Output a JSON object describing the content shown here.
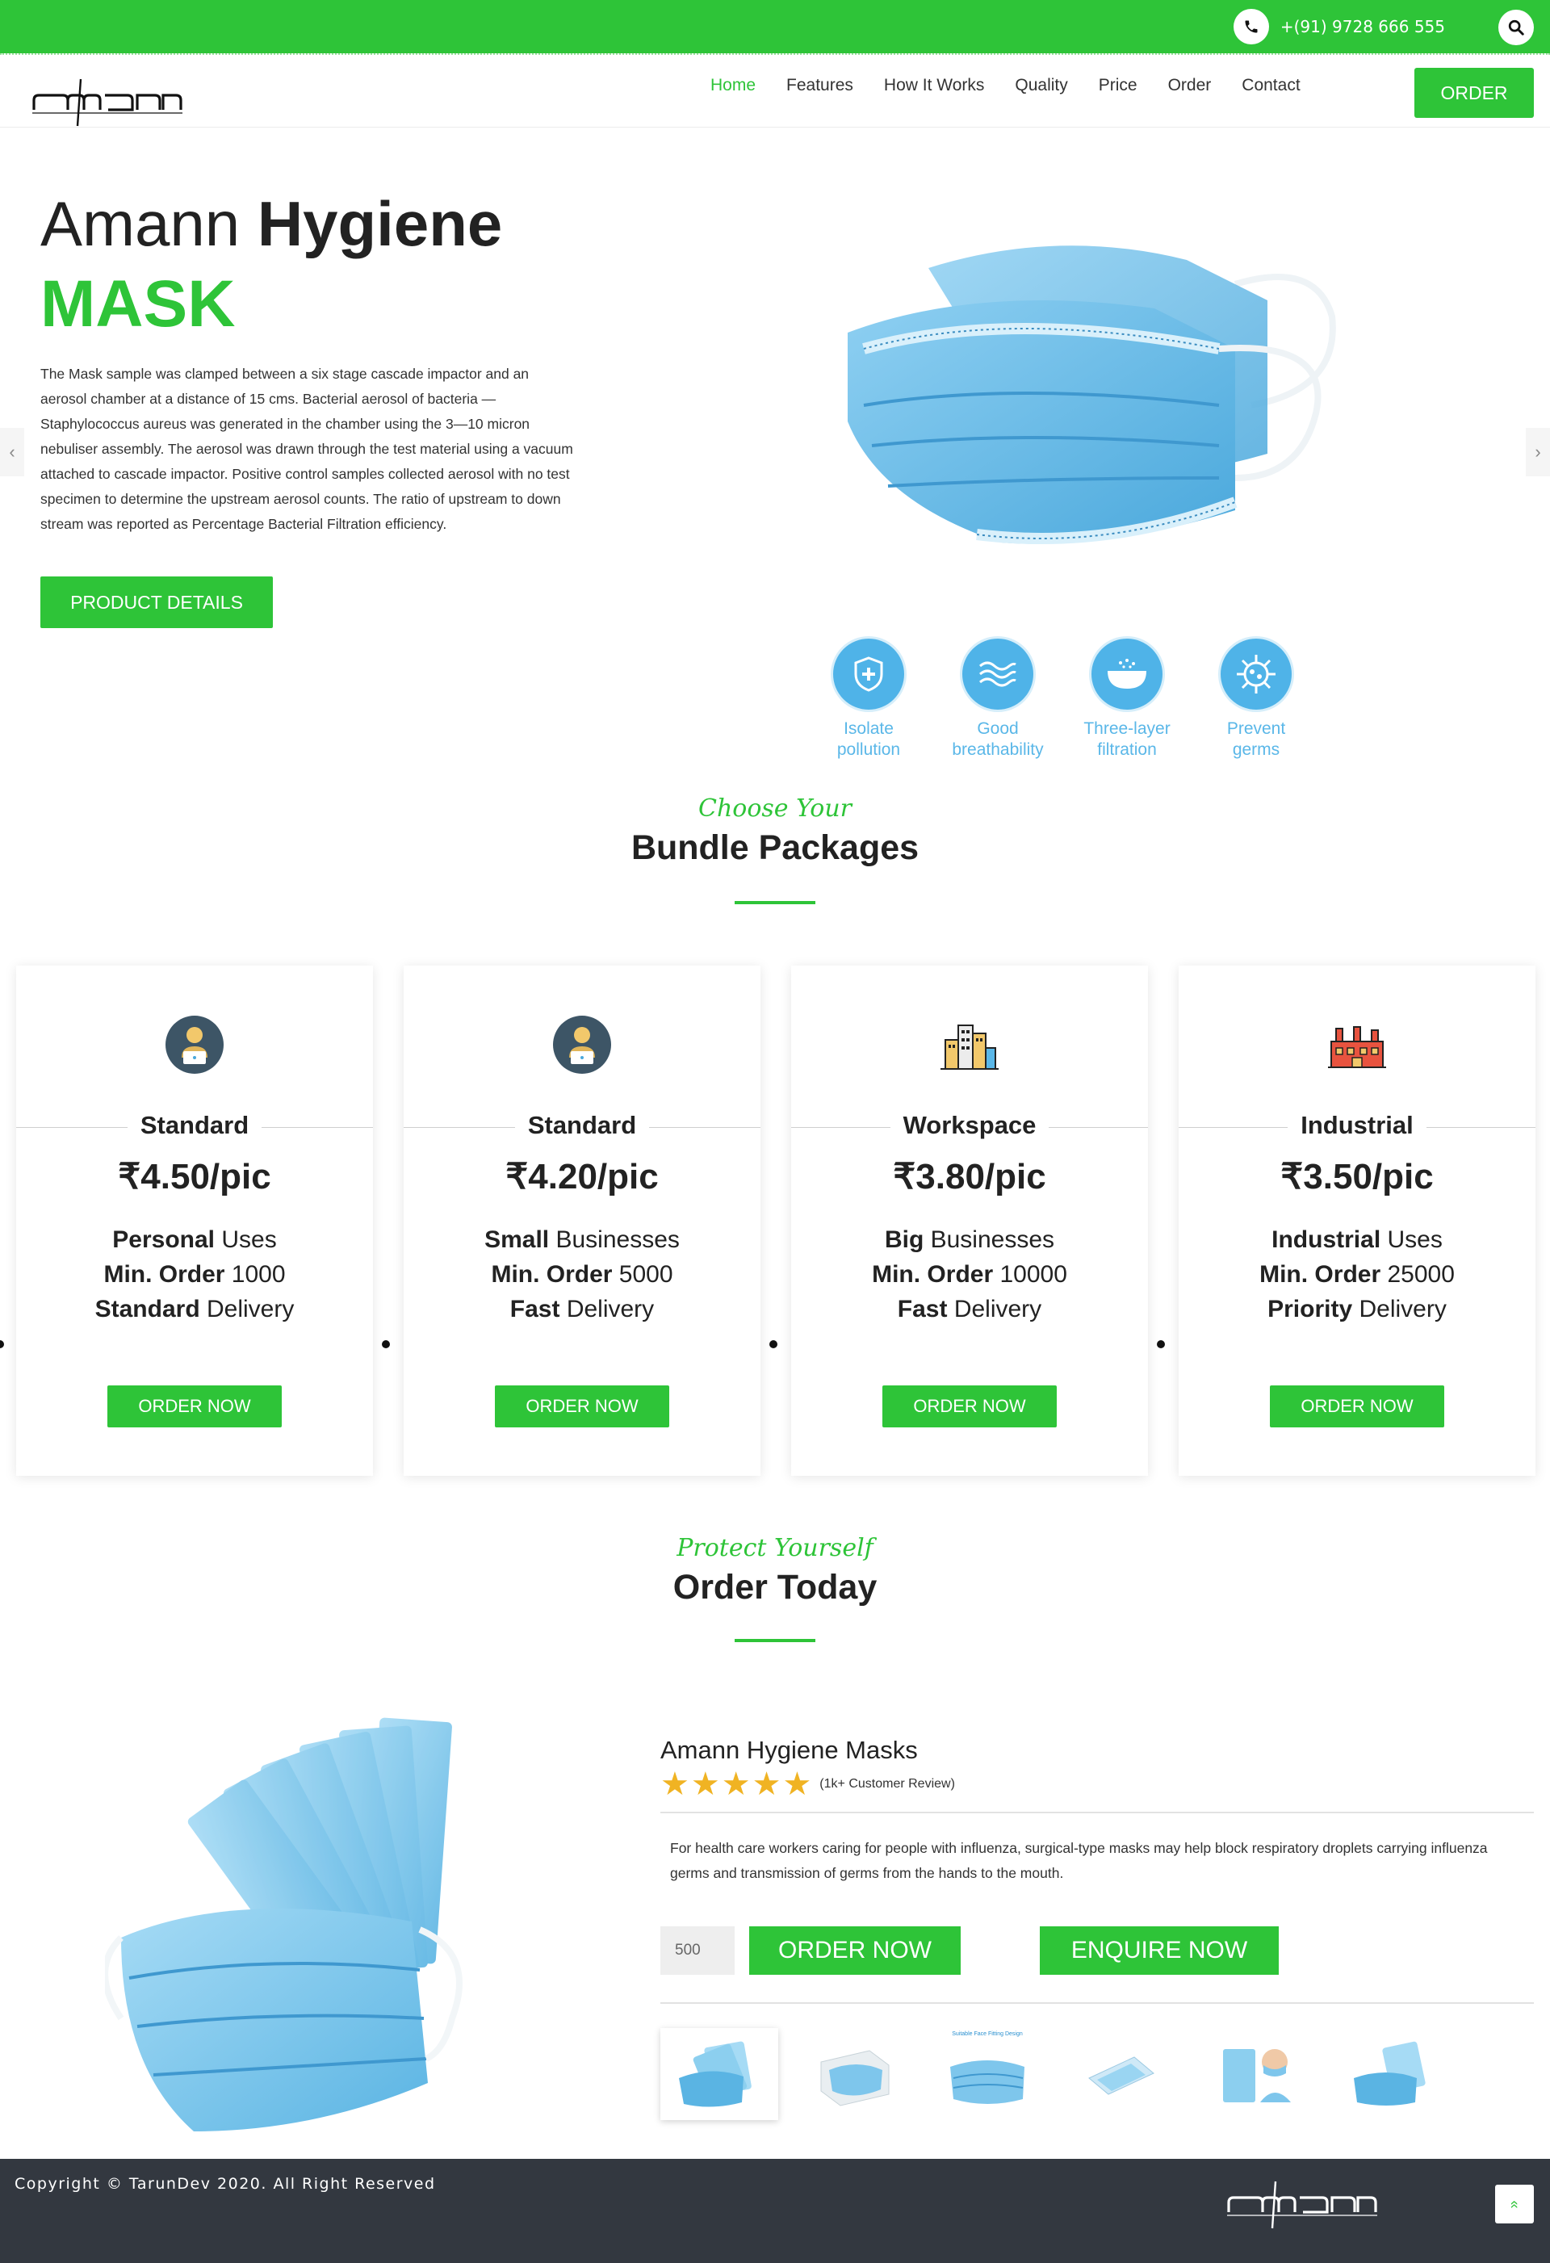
{
  "topbar": {
    "phone": "+(91) 9728 666 555"
  },
  "brand": {
    "logo_text": "amann",
    "accent_color": "#2ec438"
  },
  "nav": {
    "items": [
      {
        "label": "Home",
        "active": true
      },
      {
        "label": "Features"
      },
      {
        "label": "How It Works"
      },
      {
        "label": "Quality"
      },
      {
        "label": "Price"
      },
      {
        "label": "Order"
      },
      {
        "label": "Contact"
      }
    ],
    "cta": "ORDER"
  },
  "hero": {
    "title_light": "Amann",
    "title_bold": "Hygiene",
    "subtitle": "MASK",
    "description": "The Mask sample was clamped between a six stage cascade impactor and an aerosol chamber at a distance of 15 cms. Bacterial aerosol of bacteria — Staphylococcus aureus was generated in the chamber using the 3—10 micron nebuliser assembly. The aerosol was drawn through the test material using a vacuum attached to cascade impactor. Positive control samples collected aerosol with no test specimen to determine the upstream aerosol counts. The ratio of upstream to down stream was reported as Percentage Bacterial Filtration efficiency.",
    "button": "PRODUCT DETAILS",
    "prev_arrow": "‹",
    "next_arrow": "›",
    "features": [
      {
        "line1": "Isolate",
        "line2": "pollution",
        "icon": "shield-plus-icon"
      },
      {
        "line1": "Good",
        "line2": "breathability",
        "icon": "waves-icon"
      },
      {
        "line1": "Three-layer",
        "line2": "filtration",
        "icon": "filter-icon"
      },
      {
        "line1": "Prevent",
        "line2": "germs",
        "icon": "virus-icon"
      }
    ]
  },
  "packages": {
    "kicker": "Choose Your",
    "title": "Bundle Packages",
    "cards": [
      {
        "name": "Standard",
        "price": "₹4.50/pic",
        "l1b": "Personal",
        "l1": " Uses",
        "l2b": "Min. Order",
        "l2": " 1000",
        "l3b": "Standard",
        "l3": " Delivery",
        "button": "ORDER NOW",
        "icon": "person-laptop-icon"
      },
      {
        "name": "Standard",
        "price": "₹4.20/pic",
        "l1b": "Small",
        "l1": " Businesses",
        "l2b": "Min. Order",
        "l2": " 5000",
        "l3b": "Fast",
        "l3": " Delivery",
        "button": "ORDER NOW",
        "icon": "person-laptop-icon"
      },
      {
        "name": "Workspace",
        "price": "₹3.80/pic",
        "l1b": "Big",
        "l1": " Businesses",
        "l2b": "Min. Order",
        "l2": " 10000",
        "l3b": "Fast",
        "l3": " Delivery",
        "button": "ORDER NOW",
        "icon": "city-buildings-icon"
      },
      {
        "name": "Industrial",
        "price": "₹3.50/pic",
        "l1b": "Industrial",
        "l1": " Uses",
        "l2b": "Min. Order",
        "l2": " 25000",
        "l3b": "Priority",
        "l3": " Delivery",
        "button": "ORDER NOW",
        "icon": "factory-icon"
      }
    ]
  },
  "order": {
    "kicker": "Protect Yourself",
    "title": "Order Today",
    "product_name": "Amann Hygiene Masks",
    "rating": 5,
    "review_text": "(1k+ Customer Review)",
    "description": "For health care workers caring for people with influenza, surgical-type masks may help block respiratory droplets carrying influenza germs and transmission of germs from the hands to the mouth.",
    "quantity": "500",
    "order_button": "ORDER NOW",
    "enquire_button": "ENQUIRE NOW",
    "thumb3_caption": "Suitable Face Fitting Design"
  },
  "footer": {
    "copyright": "Copyright © TarunDev 2020. All Right Reserved",
    "to_top": "«"
  }
}
